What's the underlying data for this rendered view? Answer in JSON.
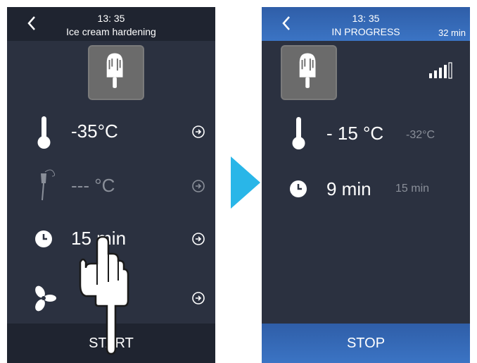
{
  "left_screen": {
    "header": {
      "time": "13: 35",
      "title": "Ice cream hardening"
    },
    "rows": [
      {
        "icon": "thermometer-icon",
        "value": "-35°C"
      },
      {
        "icon": "core-probe-icon",
        "value": "--- °C"
      },
      {
        "icon": "clock-icon",
        "value": "15 min"
      },
      {
        "icon": "fan-icon",
        "value": ""
      }
    ],
    "footer": {
      "label": "START"
    }
  },
  "right_screen": {
    "header": {
      "time": "13: 35",
      "status": "IN PROGRESS",
      "duration": "32 min"
    },
    "temperature": {
      "current": "- 15 °C",
      "target": "-32°C"
    },
    "time": {
      "current": "9 min",
      "target": "15 min"
    },
    "footer": {
      "label": "STOP"
    }
  },
  "colors": {
    "accent_arrow": "#29b6e8",
    "header_blue": "#3b74c4",
    "screen_bg": "#2b3140"
  }
}
